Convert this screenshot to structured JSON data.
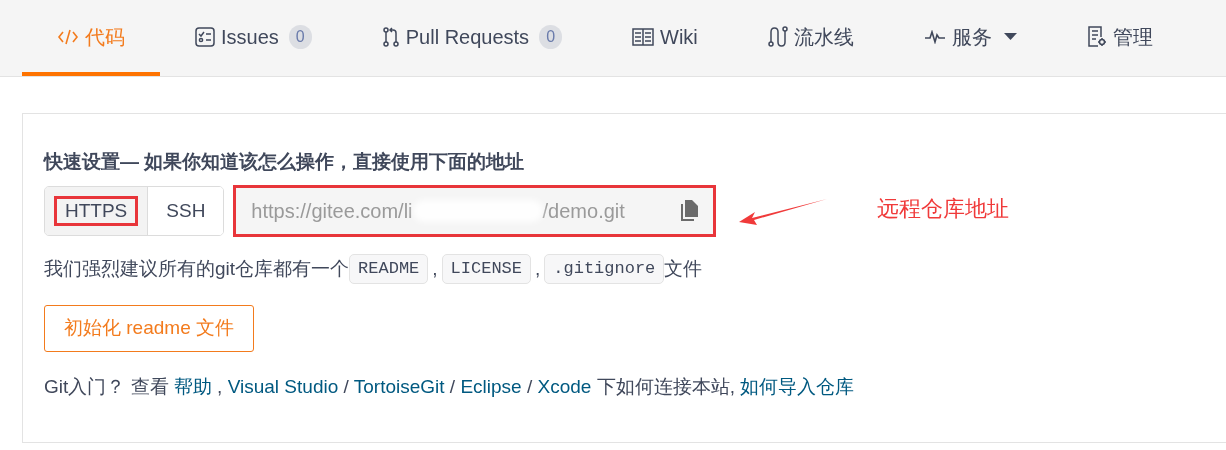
{
  "tabs": [
    {
      "label": "代码",
      "selected": true
    },
    {
      "label": "Issues",
      "count": "0",
      "selected": false
    },
    {
      "label": "Pull Requests",
      "count": "0",
      "selected": false
    },
    {
      "label": "Wiki",
      "selected": false
    },
    {
      "label": "流水线",
      "selected": false
    },
    {
      "label": "服务",
      "dropdown": true,
      "selected": false
    },
    {
      "label": "管理",
      "selected": false
    }
  ],
  "quick_setup": {
    "title": "快速设置— 如果你知道该怎么操作，直接使用下面的地址",
    "protocols": [
      {
        "label": "HTTPS",
        "selected": true,
        "highlighted": true
      },
      {
        "label": "SSH",
        "selected": false,
        "highlighted": false
      }
    ],
    "url_start": "https://gitee.com/li",
    "url_end": "/demo.git",
    "url_redacted": true,
    "url_highlighted": true,
    "recommend": {
      "before": "我们强烈建议所有的git仓库都有一个",
      "files": [
        "README",
        "LICENSE",
        ".gitignore"
      ],
      "separator": ",",
      "after": "文件"
    },
    "init_button": "初始化 readme 文件",
    "help": [
      {
        "kind": "text",
        "text": "Git入门？ 查看 "
      },
      {
        "kind": "link",
        "text": "帮助"
      },
      {
        "kind": "text",
        "text": " , "
      },
      {
        "kind": "link",
        "text": "Visual Studio"
      },
      {
        "kind": "text",
        "text": " / "
      },
      {
        "kind": "link",
        "text": "TortoiseGit"
      },
      {
        "kind": "text",
        "text": " / "
      },
      {
        "kind": "link",
        "text": "Eclipse"
      },
      {
        "kind": "text",
        "text": " / "
      },
      {
        "kind": "link",
        "text": "Xcode"
      },
      {
        "kind": "text",
        "text": " 下如何连接本站, "
      },
      {
        "kind": "link",
        "text": "如何导入仓库"
      }
    ]
  },
  "annotation": {
    "label": "远程仓库地址"
  }
}
